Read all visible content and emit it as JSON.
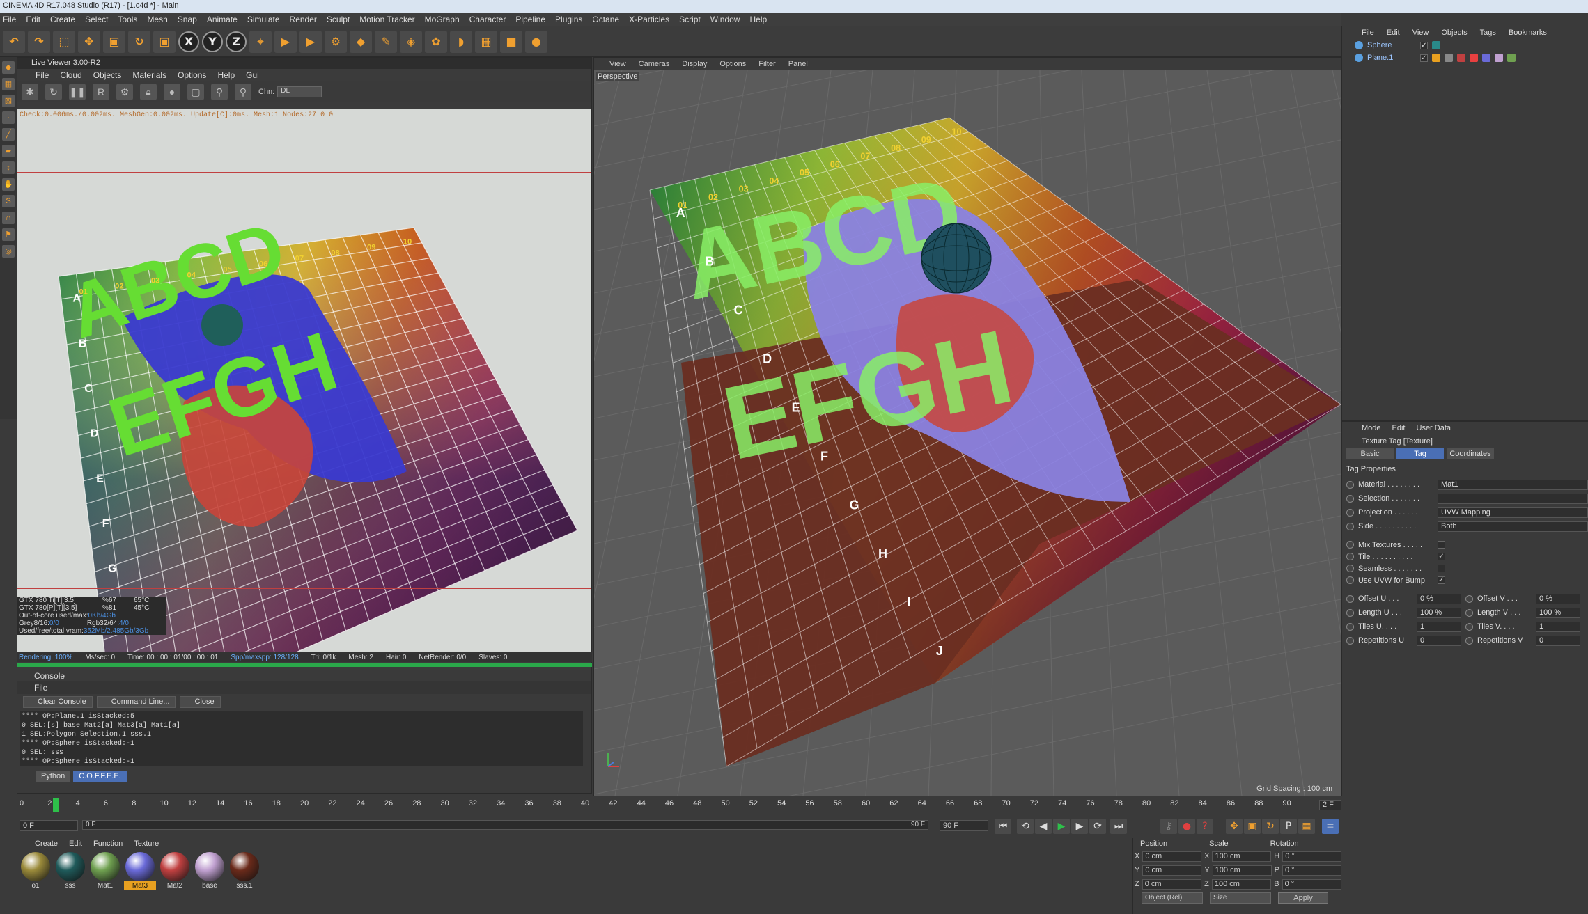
{
  "app": {
    "title": "CINEMA 4D R17.048 Studio (R17) - [1.c4d *] - Main"
  },
  "menubar": [
    "File",
    "Edit",
    "Create",
    "Select",
    "Tools",
    "Mesh",
    "Snap",
    "Animate",
    "Simulate",
    "Render",
    "Sculpt",
    "Motion Tracker",
    "MoGraph",
    "Character",
    "Pipeline",
    "Plugins",
    "Octane",
    "X-Particles",
    "Script",
    "Window",
    "Help"
  ],
  "toolbar_icons": [
    {
      "name": "undo-icon",
      "glyph": "↶"
    },
    {
      "name": "redo-icon",
      "glyph": "↷"
    },
    {
      "name": "live-selection-icon",
      "glyph": "⬚"
    },
    {
      "name": "move-icon",
      "glyph": "✥"
    },
    {
      "name": "scale-icon",
      "glyph": "▣"
    },
    {
      "name": "rotate-icon",
      "glyph": "↻"
    },
    {
      "name": "recent-tool-icon",
      "glyph": "▣"
    },
    {
      "name": "x-axis-icon",
      "glyph": "X"
    },
    {
      "name": "y-axis-icon",
      "glyph": "Y"
    },
    {
      "name": "z-axis-icon",
      "glyph": "Z"
    },
    {
      "name": "world-coords-icon",
      "glyph": "⌖"
    },
    {
      "name": "render-view-icon",
      "glyph": "▶"
    },
    {
      "name": "render-picture-viewer-icon",
      "glyph": "▶"
    },
    {
      "name": "edit-render-settings-icon",
      "glyph": "⚙"
    },
    {
      "name": "cube-icon",
      "glyph": "◆"
    },
    {
      "name": "pen-icon",
      "glyph": "✎"
    },
    {
      "name": "subdivision-icon",
      "glyph": "◈"
    },
    {
      "name": "array-icon",
      "glyph": "✿"
    },
    {
      "name": "deformer-icon",
      "glyph": "◗"
    },
    {
      "name": "floor-icon",
      "glyph": "▦"
    },
    {
      "name": "camera-icon",
      "glyph": "■"
    },
    {
      "name": "light-icon",
      "glyph": "●"
    }
  ],
  "live_viewer": {
    "title": "Live Viewer 3.00-R2",
    "menu": [
      "File",
      "Cloud",
      "Objects",
      "Materials",
      "Options",
      "Help",
      "Gui"
    ],
    "chn_label": "Chn:",
    "chn_value": "DL",
    "stats": "Check:0.006ms./0.002ms. MeshGen:0.002ms. Update[C]:0ms. Mesh:1 Nodes:27  0 0",
    "gpu": [
      {
        "name": "GTX 780 Ti[T][3.5]",
        "load": "%67",
        "temp": "65°C"
      },
      {
        "name": "GTX 780[P][T][3.5]",
        "load": "%81",
        "temp": "45°C"
      }
    ],
    "mem": [
      {
        "label": "Out-of-core used/max:",
        "value": "0Kb/4Gb"
      },
      {
        "label": "Grey8/16:",
        "value": "0/0",
        "label2": "Rgb32/64:",
        "value2": "4/0"
      },
      {
        "label": "Used/free/total vram:",
        "value": "352Mb/2.485Gb/3Gb"
      }
    ],
    "status": {
      "rendering": "Rendering: 100%",
      "ms": "Ms/sec: 0",
      "time": "Time: 00 : 00 : 01/00 : 00 : 01",
      "spp": "Spp/maxspp: 128/128",
      "tri": "Tri: 0/1k",
      "mesh": "Mesh: 2",
      "hair": "Hair: 0",
      "netrender": "NetRender: 0/0",
      "slaves": "Slaves: 0"
    }
  },
  "console": {
    "title": "Console",
    "menu": "File",
    "buttons": [
      "Clear Console",
      "Command Line...",
      "Close"
    ],
    "log": [
      "**** OP:Plane.1  isStacked:5",
      "0 SEL:[s]  base Mat2[a] Mat3[a] Mat1[a]",
      "1 SEL:Polygon Selection.1  sss.1",
      "**** OP:Sphere  isStacked:-1",
      "0 SEL:  sss",
      "**** OP:Sphere  isStacked:-1"
    ],
    "tabs": [
      "Python",
      "C.O.F.F.E.E."
    ]
  },
  "viewport": {
    "menu": [
      "View",
      "Cameras",
      "Display",
      "Options",
      "Filter",
      "Panel"
    ],
    "label": "Perspective",
    "grid_spacing": "Grid Spacing : 100 cm"
  },
  "scene": {
    "top_text": "ABCD",
    "bottom_text": "EFGH",
    "row_letters": [
      "A",
      "B",
      "C",
      "D",
      "E",
      "F",
      "G",
      "H",
      "I",
      "J"
    ],
    "col_numbers": [
      "01",
      "02",
      "03",
      "04",
      "05",
      "06",
      "07",
      "08",
      "09",
      "10"
    ]
  },
  "object_manager": {
    "menu": [
      "File",
      "Edit",
      "View",
      "Objects",
      "Tags",
      "Bookmarks"
    ],
    "objects": [
      {
        "name": "Sphere"
      },
      {
        "name": "Plane.1"
      }
    ]
  },
  "attributes": {
    "menu": [
      "Mode",
      "Edit",
      "User Data"
    ],
    "header": "Texture Tag [Texture]",
    "tabs": [
      "Basic",
      "Tag",
      "Coordinates"
    ],
    "section": "Tag Properties",
    "props": [
      {
        "label": "Material . . . . . . . .",
        "value": "Mat1"
      },
      {
        "label": "Selection . . . . . . .",
        "value": ""
      },
      {
        "label": "Projection . . . . . .",
        "value": "UVW Mapping"
      },
      {
        "label": "Side . . . . . . . . . .",
        "value": "Both"
      }
    ],
    "checks": [
      {
        "label": "Mix Textures . . . . .",
        "checked": ""
      },
      {
        "label": "Tile . . . . . . . . . .",
        "checked": "✓"
      },
      {
        "label": "Seamless . . . . . . .",
        "checked": ""
      },
      {
        "label": "Use UVW for Bump",
        "checked": "✓"
      }
    ],
    "pairs": [
      {
        "l1": "Offset U . . .",
        "v1": "0 %",
        "l2": "Offset V . . .",
        "v2": "0 %"
      },
      {
        "l1": "Length U . . .",
        "v1": "100 %",
        "l2": "Length V . . .",
        "v2": "100 %"
      },
      {
        "l1": "Tiles U. . . .",
        "v1": "1",
        "l2": "Tiles V. . . .",
        "v2": "1"
      },
      {
        "l1": "Repetitions U",
        "v1": "0",
        "l2": "Repetitions V",
        "v2": "0"
      }
    ]
  },
  "timeline": {
    "ticks": [
      "0",
      "2",
      "4",
      "6",
      "8",
      "10",
      "12",
      "14",
      "16",
      "18",
      "20",
      "22",
      "24",
      "26",
      "28",
      "30",
      "32",
      "34",
      "36",
      "38",
      "40",
      "42",
      "44",
      "46",
      "48",
      "50",
      "52",
      "54",
      "56",
      "58",
      "60",
      "62",
      "64",
      "66",
      "68",
      "70",
      "72",
      "74",
      "76",
      "78",
      "80",
      "82",
      "84",
      "86",
      "88",
      "90"
    ],
    "current_frame": "2 F",
    "start": "0 F",
    "slider_start": "0 F",
    "slider_end": "90 F",
    "end": "90 F"
  },
  "materials": {
    "menu": [
      "Create",
      "Edit",
      "Function",
      "Texture"
    ],
    "items": [
      {
        "name": "o1",
        "color": "#9a8a3a"
      },
      {
        "name": "sss",
        "color": "#1f5a5a"
      },
      {
        "name": "Mat1",
        "color": "#6fa050"
      },
      {
        "name": "Mat3",
        "color": "#6a6ad8"
      },
      {
        "name": "Mat2",
        "color": "#c04040"
      },
      {
        "name": "base",
        "color": "#c0a0d0"
      },
      {
        "name": "sss.1",
        "color": "#6a2a1a"
      }
    ],
    "selected": "Mat3"
  },
  "coords": {
    "headers": [
      "Position",
      "Scale",
      "Rotation"
    ],
    "rows": [
      {
        "a": "X",
        "p": "0 cm",
        "b": "X",
        "s": "100 cm",
        "c": "H",
        "r": "0 °"
      },
      {
        "a": "Y",
        "p": "0 cm",
        "b": "Y",
        "s": "100 cm",
        "c": "P",
        "r": "0 °"
      },
      {
        "a": "Z",
        "p": "0 cm",
        "b": "Z",
        "s": "100 cm",
        "c": "B",
        "r": "0 °"
      }
    ],
    "mode": "Object (Rel)",
    "size": "Size",
    "apply": "Apply"
  },
  "colors": {
    "accent": "#4a6fb5",
    "highlight": "#e8a020",
    "green": "#2aa84a",
    "letters": "#66dd33",
    "shape": "#4444cc"
  }
}
